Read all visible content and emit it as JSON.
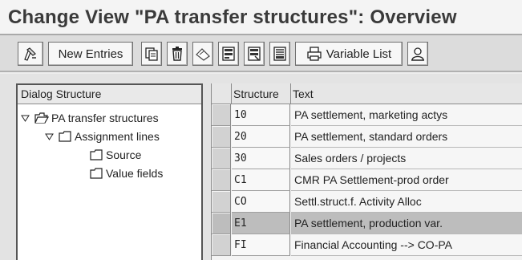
{
  "title": "Change View \"PA transfer structures\": Overview",
  "toolbar": {
    "new_entries_label": "New Entries",
    "variable_list_label": "Variable List"
  },
  "tree": {
    "header": "Dialog Structure",
    "nodes": [
      {
        "label": "PA transfer structures"
      },
      {
        "label": "Assignment lines"
      },
      {
        "label": "Source"
      },
      {
        "label": "Value fields"
      }
    ]
  },
  "table": {
    "columns": [
      "Structure",
      "Text"
    ],
    "rows": [
      {
        "structure": "10",
        "text": "PA settlement, marketing actys"
      },
      {
        "structure": "20",
        "text": "PA settlement, standard orders"
      },
      {
        "structure": "30",
        "text": "Sales orders / projects"
      },
      {
        "structure": "C1",
        "text": "CMR PA Settlement-prod order"
      },
      {
        "structure": "CO",
        "text": "Settl.struct.f. Activity Alloc"
      },
      {
        "structure": "E1",
        "text": "PA settlement, production var."
      },
      {
        "structure": "FI",
        "text": "Financial Accounting --> CO-PA"
      }
    ],
    "selected_row": "E1"
  },
  "icons": [
    "display-change-icon",
    "copy-icon",
    "delete-icon",
    "undo-icon",
    "select-all-icon",
    "select-block-icon",
    "deselect-all-icon",
    "print-icon",
    "user-icon",
    "expand-icon",
    "folder-icon"
  ],
  "colors": {
    "selected_row": "#bdbdbd",
    "toolbar": "#dcdcdc"
  }
}
